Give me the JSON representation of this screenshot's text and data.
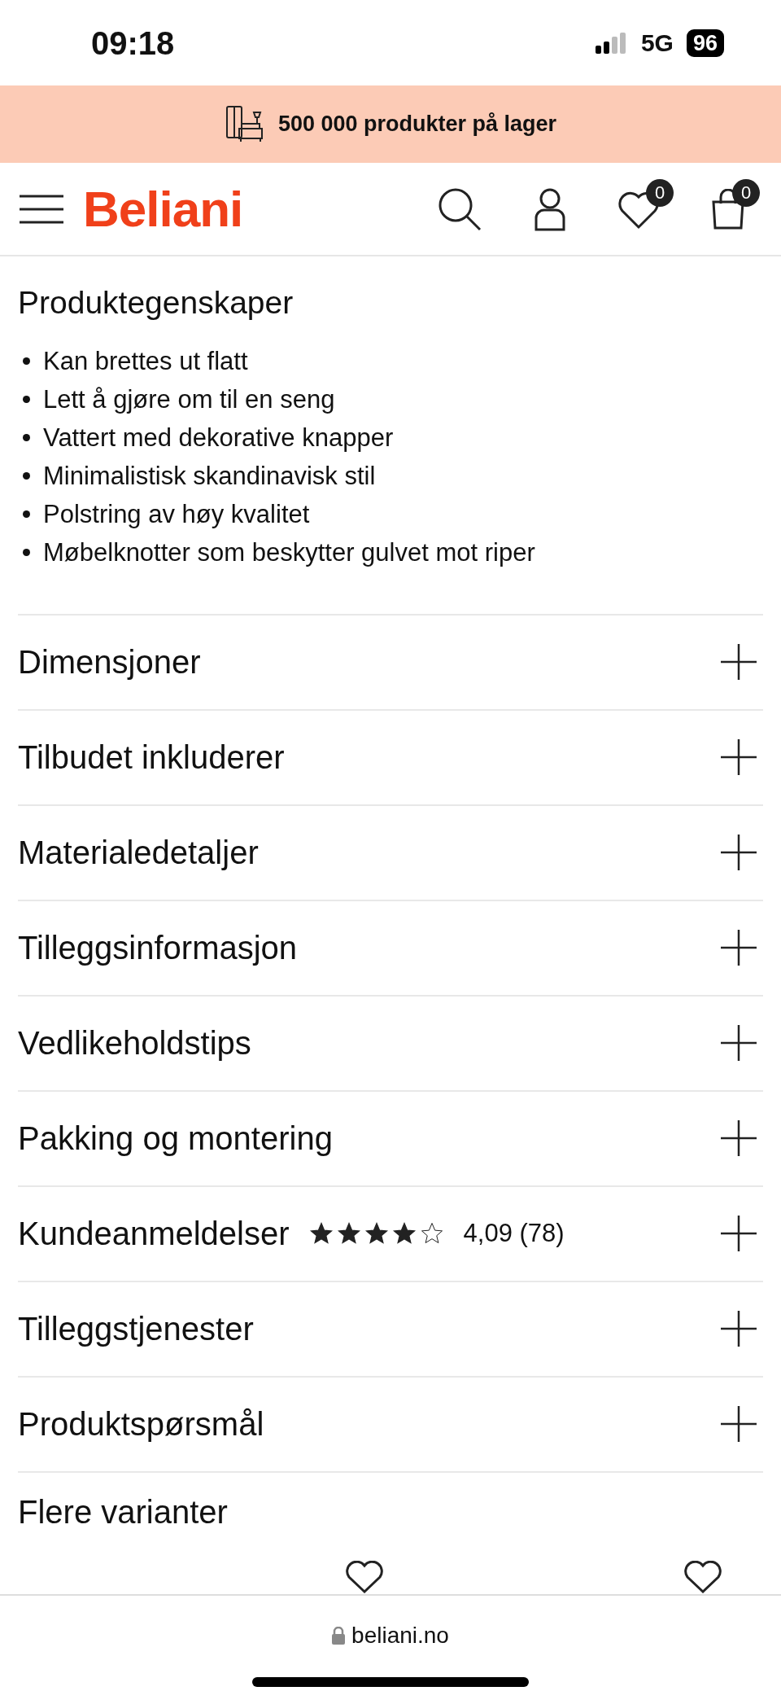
{
  "status_bar": {
    "time": "09:18",
    "network": "5G",
    "battery": "96"
  },
  "promo_banner": {
    "text": "500 000 produkter på lager"
  },
  "header": {
    "logo": "Beliani",
    "wishlist_count": "0",
    "cart_count": "0"
  },
  "features": {
    "title": "Produktegenskaper",
    "items": [
      "Kan brettes ut flatt",
      "Lett å gjøre om til en seng",
      "Vattert med dekorative knapper",
      "Minimalistisk skandinavisk stil",
      "Polstring av høy kvalitet",
      "Møbelknotter som beskytter gulvet mot riper"
    ]
  },
  "accordion": [
    {
      "kind": "plain",
      "title": "Dimensjoner",
      "expanded": false
    },
    {
      "kind": "plain",
      "title": "Tilbudet inkluderer",
      "expanded": false
    },
    {
      "kind": "plain",
      "title": "Materialedetaljer",
      "expanded": false
    },
    {
      "kind": "plain",
      "title": "Tilleggsinformasjon",
      "expanded": false
    },
    {
      "kind": "plain",
      "title": "Vedlikeholdstips",
      "expanded": false
    },
    {
      "kind": "plain",
      "title": "Pakking og montering",
      "expanded": false
    },
    {
      "kind": "rating",
      "title": "Kundeanmeldelser",
      "stars": 4,
      "rating": "4,09 (78)",
      "expanded": false
    },
    {
      "kind": "plain",
      "title": "Tilleggstjenester",
      "expanded": false
    },
    {
      "kind": "plain",
      "title": "Produktspørsmål",
      "expanded": false
    }
  ],
  "variants": {
    "title": "Flere varianter"
  },
  "browser_bar": {
    "url": "beliani.no"
  }
}
